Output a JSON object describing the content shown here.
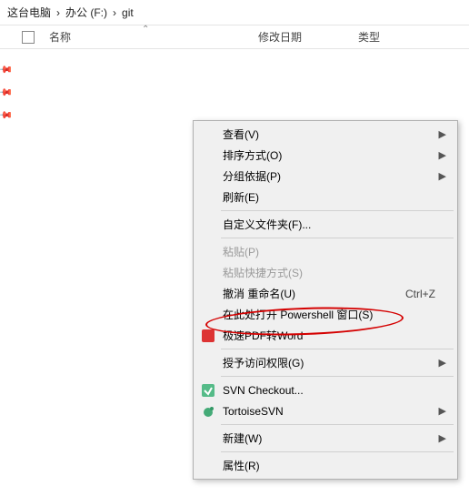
{
  "breadcrumb": {
    "pc": "这台电脑",
    "drive": "办公 (F:)",
    "folder": "git"
  },
  "columns": {
    "name": "名称",
    "date": "修改日期",
    "type": "类型"
  },
  "menu": {
    "view": "查看(V)",
    "sort": "排序方式(O)",
    "group": "分组依据(P)",
    "refresh": "刷新(E)",
    "customize": "自定义文件夹(F)...",
    "paste": "粘贴(P)",
    "paste_shortcut": "粘贴快捷方式(S)",
    "undo_rename": "撤消 重命名(U)",
    "undo_shortcut": "Ctrl+Z",
    "powershell": "在此处打开 Powershell 窗口(S)",
    "pdf_word": "极速PDF转Word",
    "grant_access": "授予访问权限(G)",
    "svn_checkout": "SVN Checkout...",
    "tortoise_svn": "TortoiseSVN",
    "new": "新建(W)",
    "properties": "属性(R)"
  }
}
